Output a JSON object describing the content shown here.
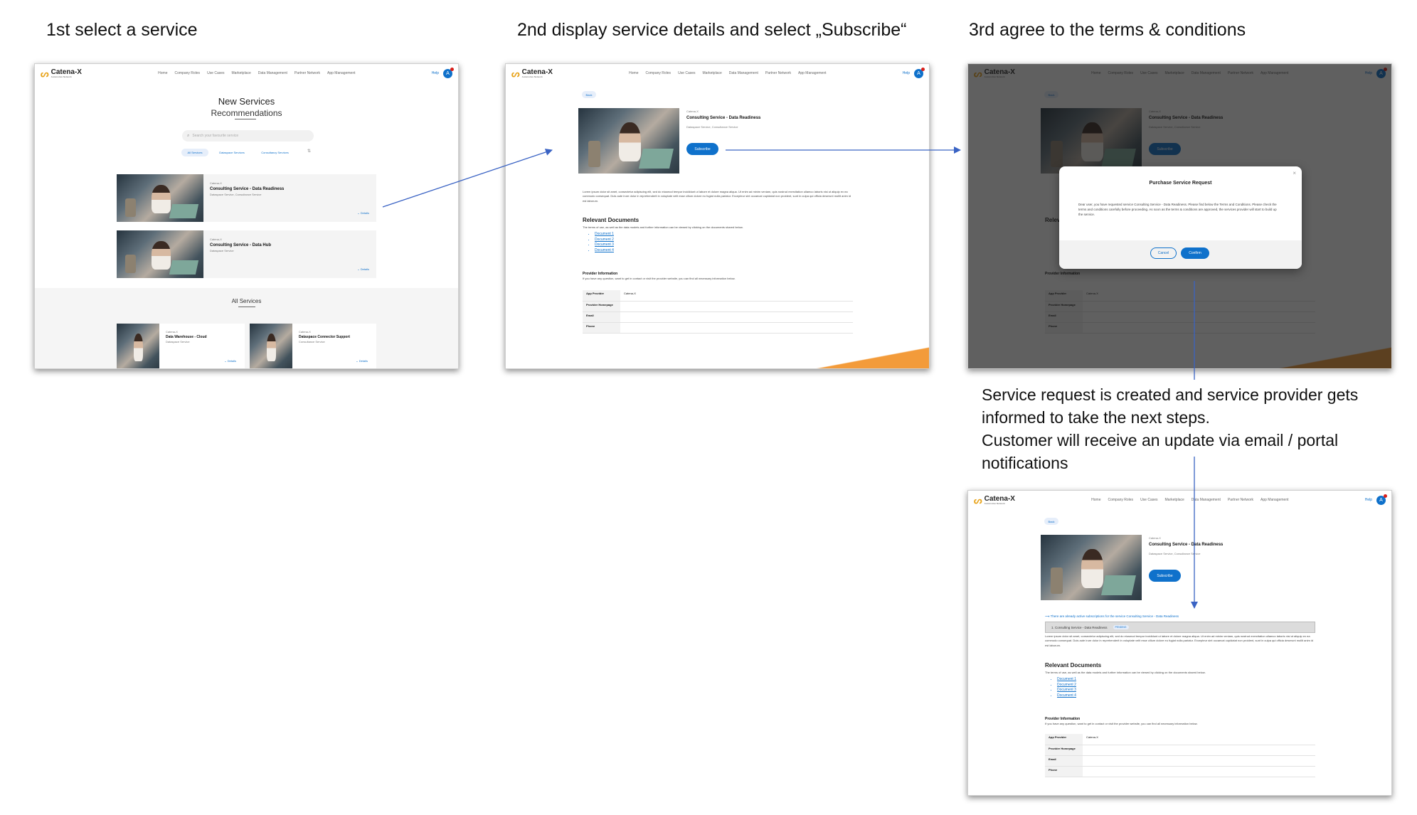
{
  "steps": {
    "step1_title": "1st select a service",
    "step2_title": "2nd display service details and select „Subscribe“",
    "step3_title": "3rd agree to the terms & conditions",
    "caption_line1": "Service request is created and service provider gets",
    "caption_line2": "informed to take the next steps.",
    "caption_line3": "Customer will receive an update via email / portal",
    "caption_line4": "notifications"
  },
  "nav": {
    "brand": "Catena-X",
    "brand_sub": "Automotive Network",
    "items": [
      "Home",
      "Company Roles",
      "Use Cases",
      "Marketplace",
      "Data Management",
      "Partner Network",
      "App Management"
    ],
    "help": "Help",
    "avatar_initial": "A"
  },
  "marketplace": {
    "title": "New Services",
    "subtitle": "Recommendations",
    "search_placeholder": "Search your favourite service",
    "filters": [
      "All Services",
      "Dataspace Services",
      "Consultancy Services"
    ],
    "cards": [
      {
        "provider": "Catena-X",
        "name": "Consulting Service - Data Readiness",
        "tags": "Dataspace Service, Consultance Service",
        "details": "Details"
      },
      {
        "provider": "Catena-X",
        "name": "Consulting Service - Data Hub",
        "tags": "Dataspace Service",
        "details": "Details"
      }
    ],
    "all_title": "All Services",
    "all_cards": [
      {
        "provider": "Catena-X",
        "name": "Data Warehouse - Cloud",
        "tags": "Dataspace Service",
        "details": "Details"
      },
      {
        "provider": "Catena-X",
        "name": "Dataspace Connector Support",
        "tags": "Consultance Service",
        "details": "Details"
      }
    ]
  },
  "detail": {
    "back": "Back",
    "provider": "Catena-X",
    "name": "Consulting Service - Data Readiness",
    "tags": "Dataspace Service, Consultance Service",
    "subscribe": "Subscribe",
    "lorem": "Lorem ipsum dolor sit amet, consectetur adipiscing elit, sed do eiusmod tempor incididunt ut labore et dolore magna aliqua. Ut enim ad minim veniam, quis nostrud exercitation ullamco laboris nisi ut aliquip ex ea commodo consequat. Duis aute irure dolor in reprehenderit in voluptate velit esse cillum dolore eu fugiat nulla pariatur. Excepteur sint occaecat cupidatat non proident, sunt in culpa qui officia deserunt mollit anim id est laborum.",
    "docs_title": "Relevant Documents",
    "docs_desc": "The terms of use, as well as the data models and further information can be viewed by clicking on the documents shared below.",
    "documents": [
      "Document 1",
      "Document 2",
      "Document 3",
      "Document 4"
    ],
    "provider_title": "Provider Information",
    "provider_desc": "If you have any question, want to get in contact or visit the provider website, you can find all necessary information below.",
    "provider_rows": [
      {
        "key": "App Provider",
        "value": "Catena-X"
      },
      {
        "key": "Provider Homepage",
        "value": ""
      },
      {
        "key": "Email",
        "value": ""
      },
      {
        "key": "Phone",
        "value": ""
      }
    ],
    "active_notice": "There are already active subscriptions for the service Consulting Service - Data Readiness",
    "subscription_item": "1.  Consulting Service - Data Readiness",
    "subscription_status": "PENDING"
  },
  "modal": {
    "title": "Purchase Service Request",
    "body": "Dear user, you have requested service Consulting Service - Data Readiness. Please find below the Terms and Conditions. Please check the terms and conditions carefully before proceeding. As soon as the terms & conditions are approved, the services provider will start to build up the service.",
    "cancel": "Cancel",
    "confirm": "Confirm"
  },
  "colors": {
    "accent": "#0f71cb",
    "brand": "#e8a319",
    "orange": "#f39b3a"
  }
}
